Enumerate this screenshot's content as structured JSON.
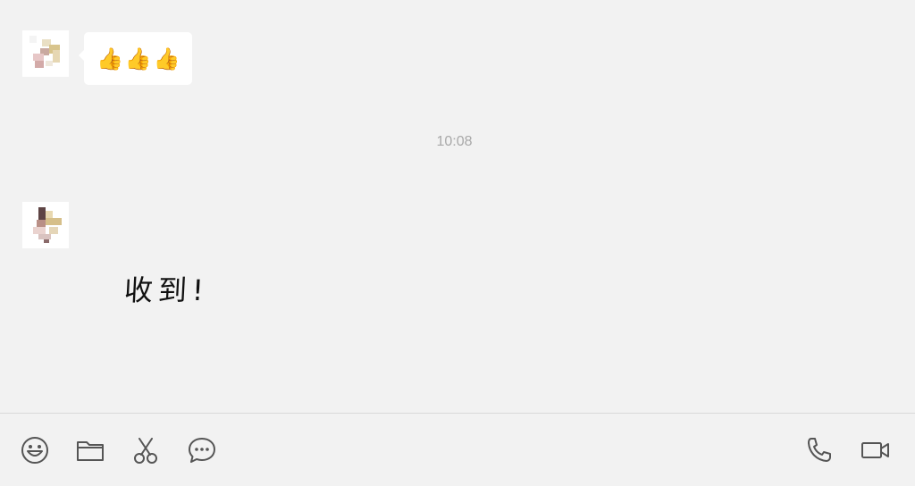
{
  "messages": {
    "first": {
      "emoji_text": "👍👍👍",
      "emoji": "thumbs-up",
      "emoji_count": 3
    },
    "timestamp": "10:08",
    "second": {
      "sticker_text": "收到!"
    }
  },
  "toolbar": {
    "left_icons": [
      "emoji-icon",
      "folder-icon",
      "scissors-icon",
      "chat-bubble-icon"
    ],
    "right_icons": [
      "phone-icon",
      "video-icon"
    ]
  },
  "colors": {
    "background": "#f2f2f2",
    "bubble": "#ffffff",
    "timestamp": "#a8a8a8",
    "icon": "#555555"
  }
}
